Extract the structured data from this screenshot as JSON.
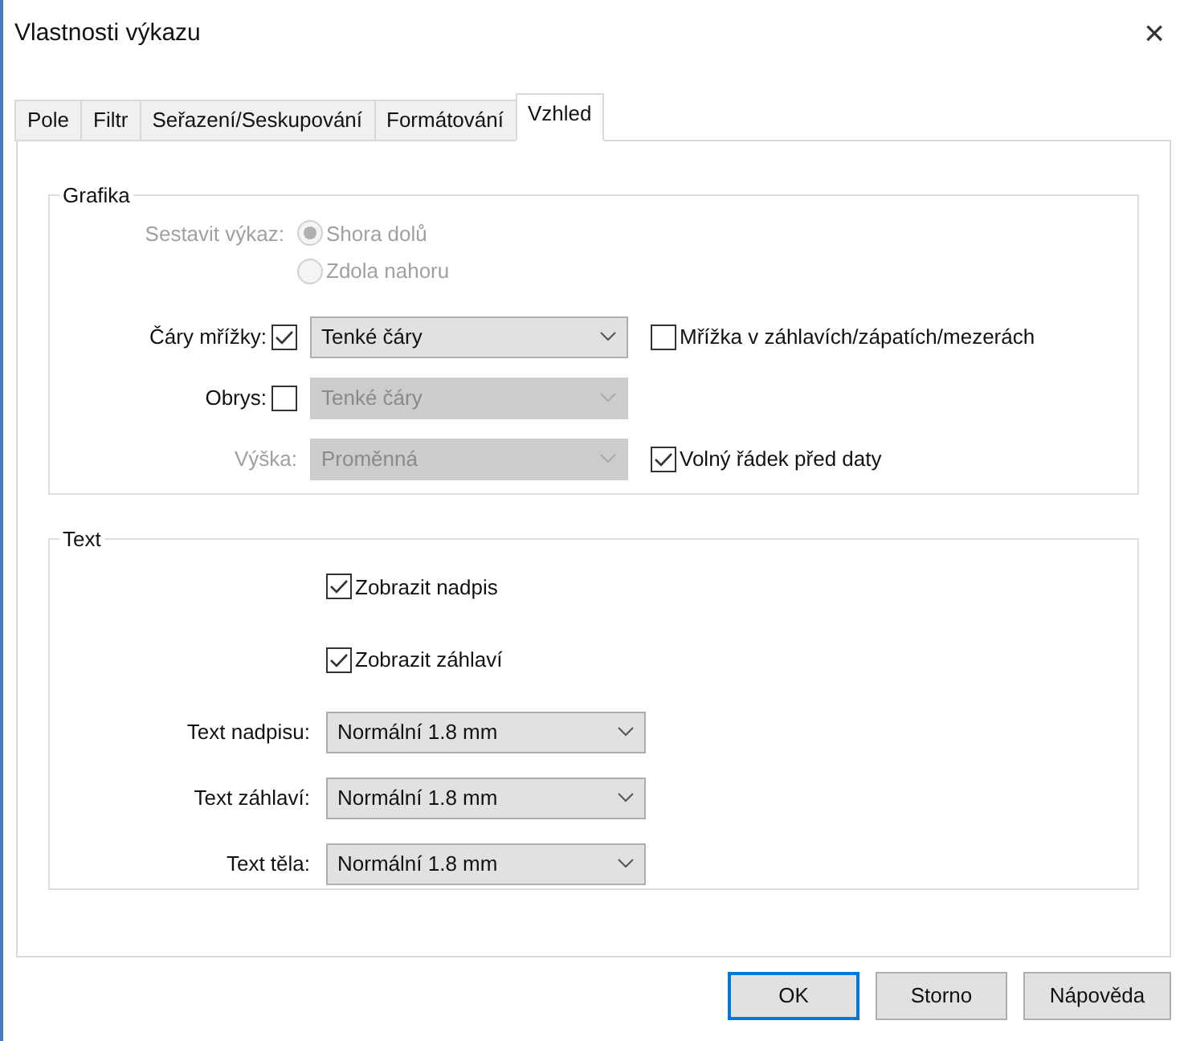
{
  "window": {
    "title": "Vlastnosti výkazu",
    "close": "×"
  },
  "tabs": [
    {
      "label": "Pole",
      "selected": false
    },
    {
      "label": "Filtr",
      "selected": false
    },
    {
      "label": "Seřazení/Seskupování",
      "selected": false
    },
    {
      "label": "Formátování",
      "selected": false
    },
    {
      "label": "Vzhled",
      "selected": true
    }
  ],
  "grafika": {
    "title": "Grafika",
    "rows": [
      {
        "kind": "radio",
        "label": "Sestavit výkaz:",
        "disabled": true,
        "options": [
          {
            "label": "Shora dolů",
            "selected": true
          },
          {
            "label": "Zdola nahoru",
            "selected": false
          }
        ]
      },
      {
        "kind": "field",
        "label": "Čáry mřížky:",
        "disabled": false,
        "checkbox": {
          "checked": true
        },
        "select": {
          "value": "Tenké čáry",
          "disabled": false
        },
        "extra": {
          "label": "Mřížka v záhlavích/zápatích/mezerách",
          "checked": false
        }
      },
      {
        "kind": "field",
        "label": "Obrys:",
        "disabled": false,
        "checkbox": {
          "checked": false
        },
        "select": {
          "value": "Tenké čáry",
          "disabled": true
        }
      },
      {
        "kind": "field",
        "label": "Výška:",
        "disabled": true,
        "select": {
          "value": "Proměnná",
          "disabled": true
        },
        "extra": {
          "label": "Volný řádek před daty",
          "checked": true
        }
      }
    ]
  },
  "text": {
    "title": "Text",
    "checkboxes": [
      {
        "label": "Zobrazit nadpis",
        "checked": true
      },
      {
        "label": "Zobrazit záhlaví",
        "checked": true
      }
    ],
    "selects": [
      {
        "label": "Text nadpisu:",
        "value": "Normální 1.8 mm"
      },
      {
        "label": "Text záhlaví:",
        "value": "Normální 1.8 mm"
      },
      {
        "label": "Text těla:",
        "value": "Normální 1.8 mm"
      }
    ]
  },
  "buttons": [
    {
      "label": "OK",
      "default": true
    },
    {
      "label": "Storno",
      "default": false
    },
    {
      "label": "Nápověda",
      "default": false
    }
  ]
}
